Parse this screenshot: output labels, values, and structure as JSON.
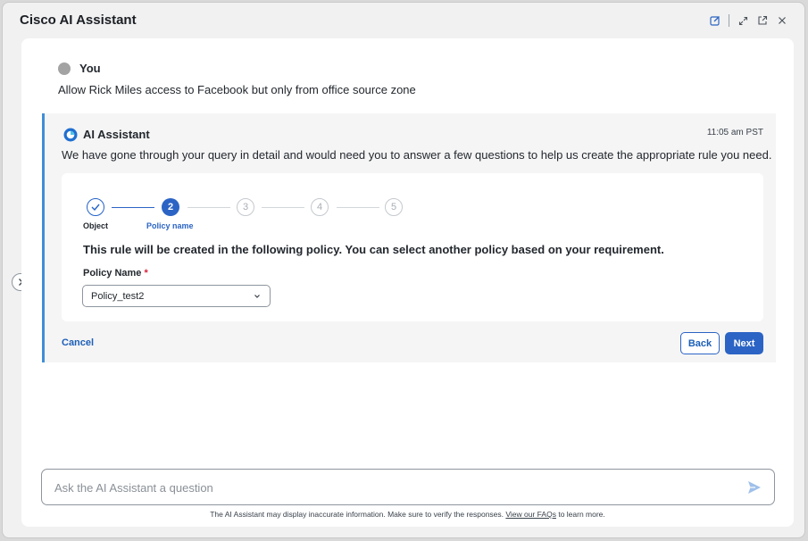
{
  "window": {
    "title": "Cisco AI Assistant",
    "toolbar_icons": [
      "edit-icon",
      "expand-icon",
      "popout-icon",
      "close-icon"
    ]
  },
  "conversation": {
    "user": {
      "name": "You",
      "message": "Allow Rick Miles access to Facebook but only from office source zone"
    },
    "assistant": {
      "name": "AI Assistant",
      "time": "11:05 am PST",
      "message": "We have gone through your query in detail and would need you to answer a few questions to help us create the appropriate rule you need."
    }
  },
  "wizard": {
    "steps": [
      {
        "number": "1",
        "label": "Object",
        "state": "done"
      },
      {
        "number": "2",
        "label": "Policy name",
        "state": "active"
      },
      {
        "number": "3",
        "label": "",
        "state": "todo"
      },
      {
        "number": "4",
        "label": "",
        "state": "todo"
      },
      {
        "number": "5",
        "label": "",
        "state": "todo"
      }
    ],
    "heading": "This rule will be created in the following policy. You can select another policy based on your requirement.",
    "field_label": "Policy Name",
    "required_mark": "*",
    "selected_policy": "Policy_test2"
  },
  "actions": {
    "cancel": "Cancel",
    "back": "Back",
    "next": "Next"
  },
  "composer": {
    "placeholder": "Ask the AI Assistant a question"
  },
  "disclaimer": {
    "text": "The AI Assistant may display inaccurate information. Make sure to verify the responses.",
    "link": "View our FAQs",
    "suffix": "to learn more."
  },
  "colors": {
    "accent": "#2b64c4",
    "card_border": "#3f8ed8",
    "required": "#d4243b"
  }
}
